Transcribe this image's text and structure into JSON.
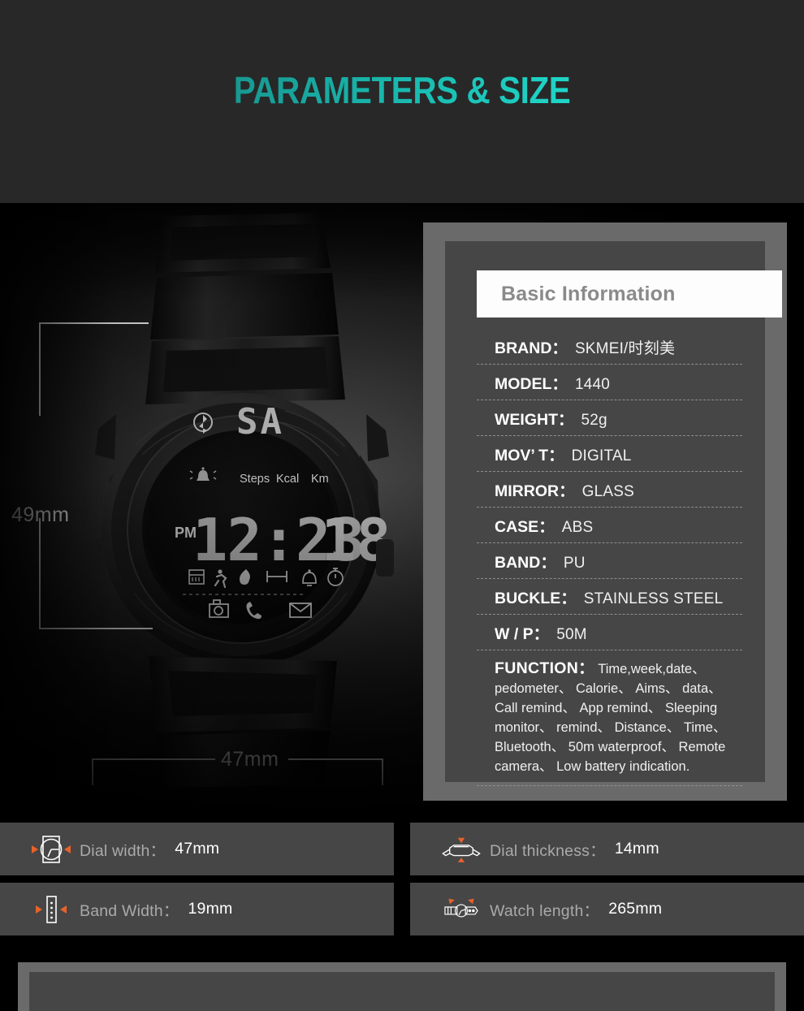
{
  "header": {
    "title": "PARAMETERS & SIZE",
    "gradient_from": "#12716e",
    "gradient_to": "#25e6d6",
    "background": "#282828"
  },
  "photo": {
    "alt": "black digital sport watch front view",
    "dimensions": {
      "height_label": "49mm",
      "width_label": "47mm"
    },
    "watch_display": {
      "top_value": "SA",
      "meridiem": "PM",
      "time": "12:23",
      "secondary": "18",
      "metric_labels": [
        "Steps",
        "Kcal",
        "Km"
      ],
      "status_icons": [
        "bluetooth-icon",
        "alarm-bell-icon"
      ],
      "function_icons": [
        "calendar-icon",
        "running-icon",
        "flame-icon",
        "distance-icon",
        "bell-icon",
        "stopwatch-icon"
      ],
      "bottom_icons": [
        "camera-icon",
        "phone-icon",
        "envelope-icon"
      ]
    }
  },
  "spec_panel": {
    "heading": "Basic Information",
    "frame_color": "#6a6a6a",
    "panel_color": "#464646",
    "rows": [
      {
        "label": "BRAND",
        "colon": "：",
        "value": "SKMEI/时刻美",
        "spacing": "none"
      },
      {
        "label": "MODEL",
        "colon": "：",
        "value": "1440",
        "spacing": "none"
      },
      {
        "label": "WEIGHT",
        "colon": "：",
        "value": "52g",
        "spacing": "none"
      },
      {
        "label": "MOV’ T",
        "colon": "：",
        "value": "DIGITAL",
        "spacing": "none"
      },
      {
        "label": "MIRROR",
        "colon": "：",
        "value": "GLASS",
        "spacing": "none"
      },
      {
        "label": "CASE",
        "colon": "：",
        "value": "ABS",
        "spacing": "wide"
      },
      {
        "label": "BAND",
        "colon": "：",
        "value": "PU",
        "spacing": "wide"
      },
      {
        "label": "BUCKLE",
        "colon": "：",
        "value": "STAINLESS STEEL",
        "spacing": "none"
      },
      {
        "label": "W / P",
        "colon": "：",
        "value": "50M",
        "spacing": "medium"
      }
    ],
    "function": {
      "label": "FUNCTION",
      "colon": "：",
      "text": "Time,week,date、 pedometer、 Calorie、 Aims、 data、 Call remind、 App remind、 Sleeping monitor、 remind、 Distance、 Time、 Bluetooth、 50m waterproof、 Remote camera、 Low battery indication."
    }
  },
  "info_bars": [
    {
      "icon": "dial-width-icon",
      "label": "Dial width",
      "colon": "：",
      "value": "47mm"
    },
    {
      "icon": "dial-thickness-icon",
      "label": "Dial thickness",
      "colon": "：",
      "value": "14mm"
    },
    {
      "icon": "band-width-icon",
      "label": "Band Width",
      "colon": "：",
      "value": "19mm"
    },
    {
      "icon": "watch-length-icon",
      "label": "Watch length",
      "colon": "：",
      "value": "265mm"
    }
  ],
  "colors": {
    "accent_orange": "#e8622a",
    "label_gray": "#aaaaaa",
    "value_white": "#ffffff",
    "panel_bg": "#464646",
    "frame_bg": "#6a6a6a"
  }
}
